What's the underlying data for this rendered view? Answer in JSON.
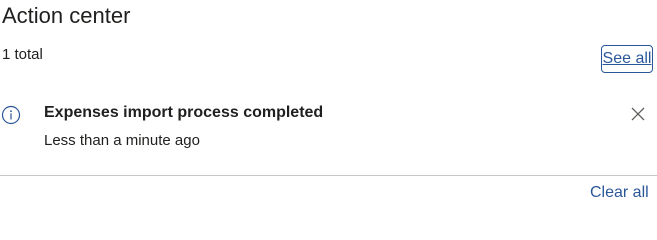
{
  "header": {
    "title": "Action center",
    "count_text": "1 total",
    "see_all_label": "See all"
  },
  "notifications": [
    {
      "icon": "info-icon",
      "title": "Expenses import process completed",
      "time": "Less than a minute ago",
      "dismiss_icon": "close-icon"
    }
  ],
  "footer": {
    "clear_all_label": "Clear all"
  },
  "colors": {
    "link": "#2b579a",
    "text": "#201f1e",
    "divider": "#c8c6c4"
  }
}
